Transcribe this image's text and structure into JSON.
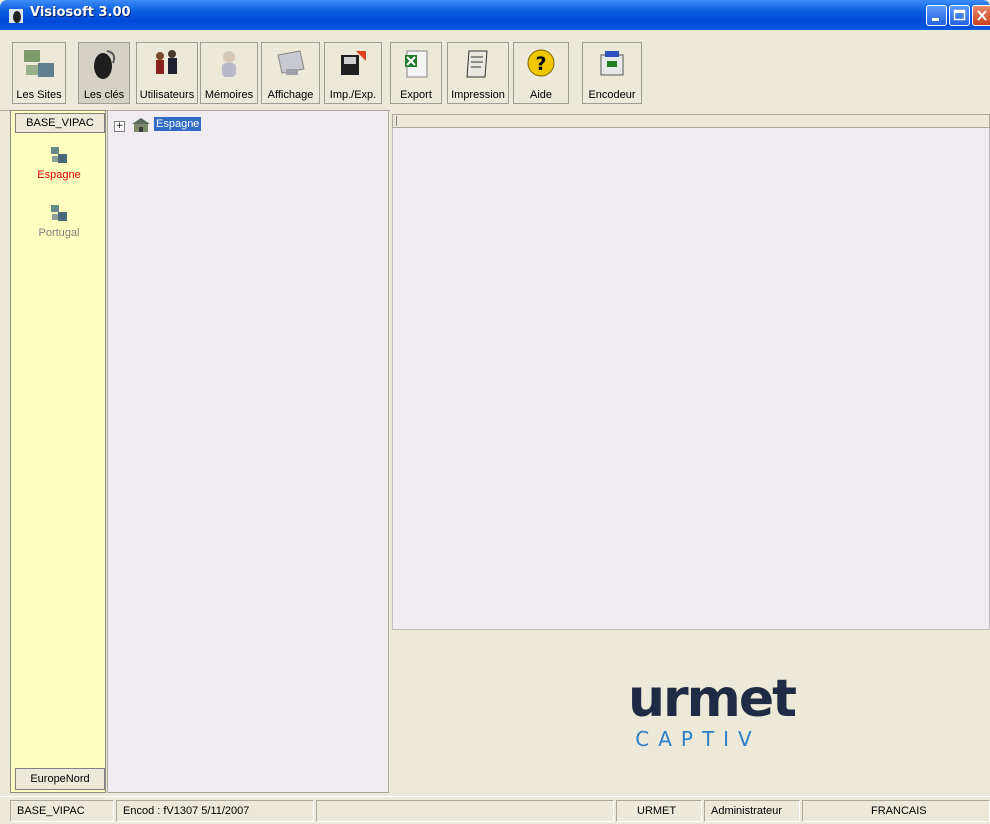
{
  "window": {
    "title": "Visiosoft 3.00"
  },
  "toolbar": {
    "buttons": [
      {
        "label": "Les Sites",
        "icon": "sites-icon"
      },
      {
        "label": "Les clés",
        "icon": "key-icon"
      },
      {
        "label": "Utilisateurs",
        "icon": "users-icon"
      },
      {
        "label": "Mémoires",
        "icon": "memory-icon"
      },
      {
        "label": "Affichage",
        "icon": "display-icon"
      },
      {
        "label": "Imp./Exp.",
        "icon": "import-export-icon"
      },
      {
        "label": "Export",
        "icon": "excel-icon"
      },
      {
        "label": "Impression",
        "icon": "print-icon"
      },
      {
        "label": "Aide",
        "icon": "help-icon"
      },
      {
        "label": "Encodeur",
        "icon": "encoder-icon"
      }
    ]
  },
  "sidebar": {
    "header": "BASE_VIPAC",
    "sites": [
      {
        "label": "Espagne",
        "color": "#e00000"
      },
      {
        "label": "Portugal",
        "color": "#808080"
      }
    ],
    "footer": "EuropeNord"
  },
  "tree": {
    "root_label": "Espagne",
    "expander": "+"
  },
  "logo": {
    "main": "urmet",
    "sub": "CAPTIV"
  },
  "statusbar": {
    "database": "BASE_VIPAC",
    "encoder": "Encod : fV1307  5/11/2007",
    "empty": "",
    "company": "URMET",
    "role": "Administrateur",
    "language": "FRANCAIS"
  }
}
